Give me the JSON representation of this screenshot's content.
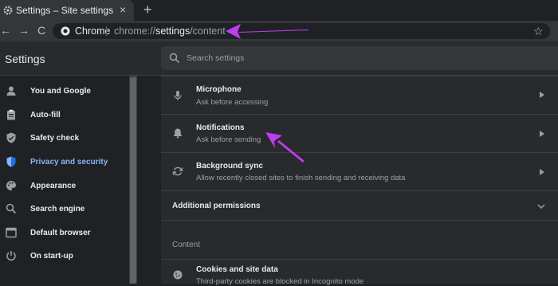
{
  "tab": {
    "title": "Settings – Site settings",
    "close": "×",
    "new_tab": "+"
  },
  "toolbar": {
    "back": "←",
    "forward": "→",
    "reload": "C",
    "chip": "Chrome",
    "url_prefix": "chrome://",
    "url_bold": "settings",
    "url_suffix": "/content",
    "star": "☆"
  },
  "header": {
    "title": "Settings",
    "search_placeholder": "Search settings"
  },
  "sidebar": {
    "items": [
      {
        "label": "You and Google",
        "icon": "person-icon",
        "active": false
      },
      {
        "label": "Auto-fill",
        "icon": "clipboard-icon",
        "active": false
      },
      {
        "label": "Safety check",
        "icon": "shield-check-icon",
        "active": false
      },
      {
        "label": "Privacy and security",
        "icon": "shield-icon",
        "active": true
      },
      {
        "label": "Appearance",
        "icon": "palette-icon",
        "active": false
      },
      {
        "label": "Search engine",
        "icon": "search-icon",
        "active": false
      },
      {
        "label": "Default browser",
        "icon": "browser-icon",
        "active": false
      },
      {
        "label": "On start-up",
        "icon": "power-icon",
        "active": false
      }
    ]
  },
  "content": {
    "rows": [
      {
        "title": "Microphone",
        "subtitle": "Ask before accessing",
        "icon": "microphone-icon"
      },
      {
        "title": "Notifications",
        "subtitle": "Ask before sending",
        "icon": "bell-icon"
      },
      {
        "title": "Background sync",
        "subtitle": "Allow recently closed sites to finish sending and receiving data",
        "icon": "sync-icon"
      }
    ],
    "additional_permissions": "Additional permissions",
    "content_section": "Content",
    "cookies": {
      "title": "Cookies and site data",
      "subtitle": "Third-party cookies are blocked in Incognito mode",
      "icon": "cookie-icon"
    }
  },
  "colors": {
    "accent": "#8ab4f8",
    "annotation_arrow": "#c03cf0",
    "background": "#202124",
    "card": "#292a2d"
  }
}
